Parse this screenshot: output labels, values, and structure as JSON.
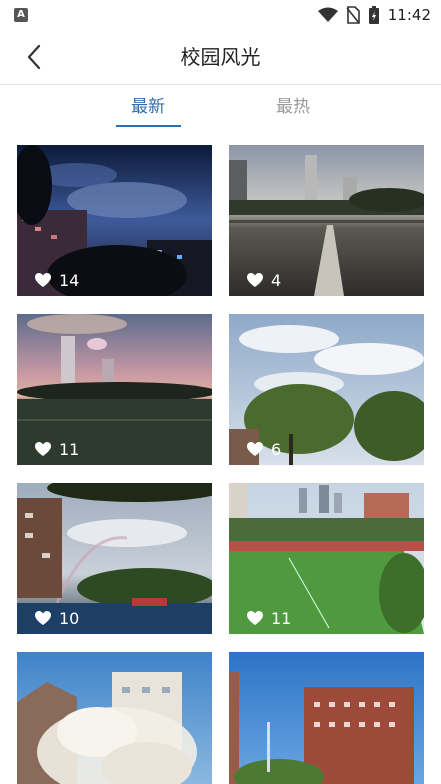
{
  "status": {
    "time": "11:42",
    "app_icon": "A"
  },
  "header": {
    "title": "校园风光",
    "back_icon": "chevron-left-icon"
  },
  "tabs": [
    {
      "label": "最新",
      "active": true
    },
    {
      "label": "最热",
      "active": false
    }
  ],
  "photos": [
    {
      "likes": "14",
      "scene": "night-sky-campus"
    },
    {
      "likes": "4",
      "scene": "dusk-running-track"
    },
    {
      "likes": "11",
      "scene": "sunset-sports-field"
    },
    {
      "likes": "6",
      "scene": "clouds-and-trees"
    },
    {
      "likes": "10",
      "scene": "rainbow-and-pool"
    },
    {
      "likes": "11",
      "scene": "green-football-field"
    },
    {
      "likes": "",
      "scene": "blossom-building"
    },
    {
      "likes": "",
      "scene": "red-brick-building"
    }
  ],
  "colors": {
    "accent": "#2f6fb0",
    "inactive_tab": "#9a9a9a"
  }
}
